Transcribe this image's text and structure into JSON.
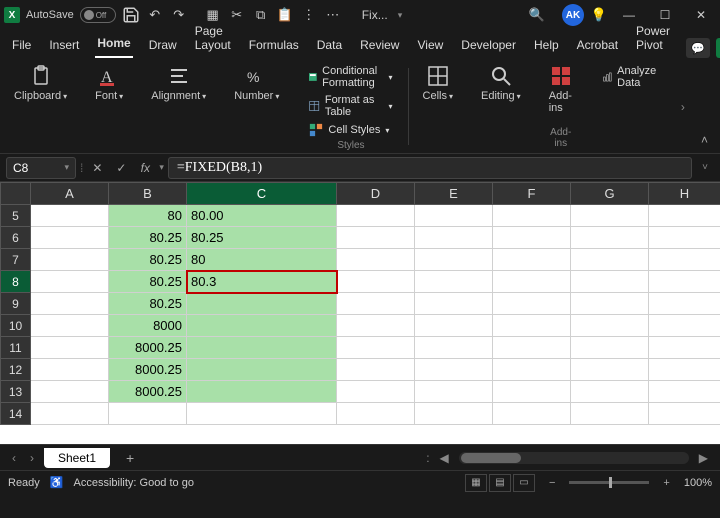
{
  "titlebar": {
    "autosave_label": "AutoSave",
    "autosave_state": "Off",
    "doc_name": "Fix...",
    "avatar": "AK"
  },
  "tabs": [
    "File",
    "Insert",
    "Home",
    "Draw",
    "Page Layout",
    "Formulas",
    "Data",
    "Review",
    "View",
    "Developer",
    "Help",
    "Acrobat",
    "Power Pivot"
  ],
  "active_tab": "Home",
  "ribbon": {
    "clipboard": "Clipboard",
    "font": "Font",
    "alignment": "Alignment",
    "number": "Number",
    "cond_fmt": "Conditional Formatting",
    "fmt_table": "Format as Table",
    "cell_styles": "Cell Styles",
    "styles_label": "Styles",
    "cells": "Cells",
    "editing": "Editing",
    "addins": "Add-ins",
    "addins_label": "Add-ins",
    "analyze": "Analyze Data"
  },
  "formula_bar": {
    "cell_ref": "C8",
    "formula": "=FIXED(B8,1)"
  },
  "columns": [
    "A",
    "B",
    "C",
    "D",
    "E",
    "F",
    "G",
    "H"
  ],
  "rows": [
    {
      "n": "5",
      "b": "80",
      "c": "80.00"
    },
    {
      "n": "6",
      "b": "80.25",
      "c": "80.25"
    },
    {
      "n": "7",
      "b": "80.25",
      "c": "80"
    },
    {
      "n": "8",
      "b": "80.25",
      "c": "80.3",
      "sel": true
    },
    {
      "n": "9",
      "b": "80.25",
      "c": ""
    },
    {
      "n": "10",
      "b": "8000",
      "c": ""
    },
    {
      "n": "11",
      "b": "8000.25",
      "c": ""
    },
    {
      "n": "12",
      "b": "8000.25",
      "c": ""
    },
    {
      "n": "13",
      "b": "8000.25",
      "c": ""
    },
    {
      "n": "14",
      "b": "",
      "c": "",
      "plain": true
    }
  ],
  "sheet": {
    "name": "Sheet1"
  },
  "status": {
    "ready": "Ready",
    "accessibility": "Accessibility: Good to go",
    "zoom": "100%"
  }
}
